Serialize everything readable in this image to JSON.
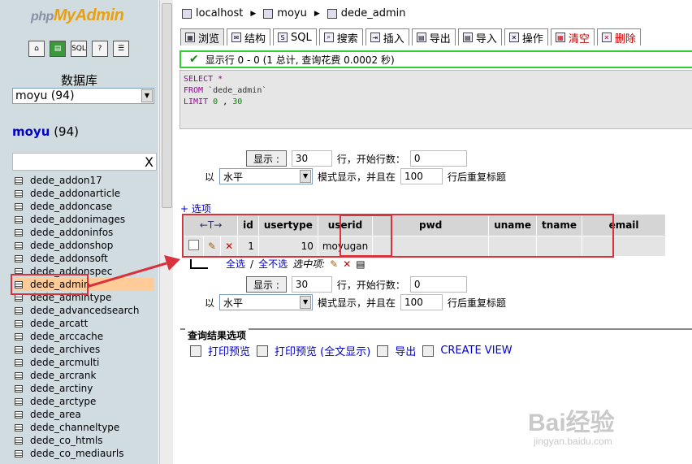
{
  "left": {
    "logo_small": "php",
    "logo_big": "MyAdmin",
    "icons": [
      "home-icon",
      "sql-query-icon",
      "sql-window-icon",
      "help-icon",
      "docs-icon"
    ],
    "db_label": "数据库",
    "db_select_value": "moyu (94)",
    "db_title_name": "moyu",
    "db_title_count": "(94)",
    "filter_clear": "X",
    "tables": [
      "dede_addon17",
      "dede_addonarticle",
      "dede_addoncase",
      "dede_addonimages",
      "dede_addoninfos",
      "dede_addonshop",
      "dede_addonsoft",
      "dede_addonspec",
      "dede_admin",
      "dede_admintype",
      "dede_advancedsearch",
      "dede_arcatt",
      "dede_arccache",
      "dede_archives",
      "dede_arcmulti",
      "dede_arcrank",
      "dede_arctiny",
      "dede_arctype",
      "dede_area",
      "dede_channeltype",
      "dede_co_htmls",
      "dede_co_mediaurls"
    ],
    "active_table": "dede_admin"
  },
  "breadcrumb": {
    "server": "localhost",
    "db": "moyu",
    "table": "dede_admin"
  },
  "tabs": [
    {
      "label": "浏览",
      "icon": "browse-icon"
    },
    {
      "label": "结构",
      "icon": "structure-icon"
    },
    {
      "label": "SQL",
      "icon": "sql-icon"
    },
    {
      "label": "搜索",
      "icon": "search-icon"
    },
    {
      "label": "插入",
      "icon": "insert-icon"
    },
    {
      "label": "导出",
      "icon": "export-icon"
    },
    {
      "label": "导入",
      "icon": "import-icon"
    },
    {
      "label": "操作",
      "icon": "operations-icon"
    },
    {
      "label": "清空",
      "icon": "empty-icon"
    },
    {
      "label": "删除",
      "icon": "drop-icon"
    }
  ],
  "success_msg": "显示行 0 - 0 (1 总计, 查询花费 0.0002 秒)",
  "sql": {
    "select": "SELECT",
    "star": "*",
    "from": "FROM",
    "table": "`dede_admin`",
    "limit": "LIMIT",
    "offset": "0",
    "comma": ",",
    "count": "30"
  },
  "nav": {
    "show_btn": "显示 :",
    "rows": "30",
    "rows_label": "行，开始行数：",
    "start": "0",
    "mode_prefix": "以",
    "mode": "水平",
    "mode_label": "模式显示，并且在",
    "repeat": "100",
    "repeat_label": "行后重复标题"
  },
  "options_link": "+ 选项",
  "grid": {
    "sort_arrows": "←T→",
    "columns": [
      "id",
      "usertype",
      "userid",
      "pwd",
      "uname",
      "tname",
      "email"
    ],
    "row": {
      "id": "1",
      "usertype": "10",
      "userid": "moyugan",
      "pwd": "",
      "uname": "",
      "tname": "",
      "email": ""
    }
  },
  "below_grid": {
    "check_all": "全选",
    "slash": "/",
    "uncheck_all": "全不选",
    "selected": "选中项:"
  },
  "query_results": {
    "legend": "查询结果选项",
    "print_view": "打印预览",
    "print_view_full": "打印预览 (全文显示)",
    "export": "导出",
    "create_view": "CREATE VIEW"
  },
  "watermark": {
    "brand": "Bai经验",
    "url": "jingyan.baidu.com"
  },
  "annotation_color": "#d8323c"
}
